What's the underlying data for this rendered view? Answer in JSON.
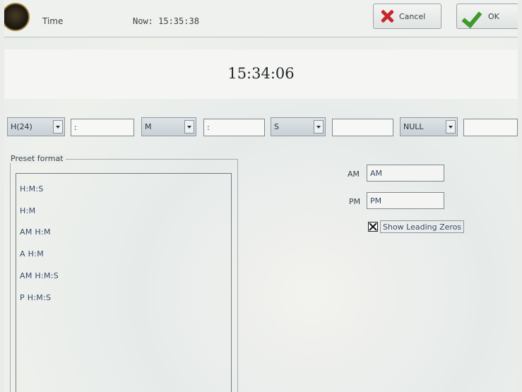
{
  "header": {
    "title": "Time",
    "now_label": "Now: 15:35:38",
    "cancel_label": "Cancel",
    "ok_label": "OK"
  },
  "clock": {
    "display": "15:34:06"
  },
  "format_row": {
    "hour_select": "H(24)",
    "sep1": ":",
    "minute_select": "M",
    "sep2": ":",
    "second_select": "S",
    "sep3": "",
    "ampm_select": "NULL",
    "sep4": ""
  },
  "preset": {
    "label": "Preset format",
    "items": [
      "H:M:S",
      "H:M",
      "AM H:M",
      "A H:M",
      "AM H:M:S",
      "P H:M:S"
    ]
  },
  "ampm": {
    "am_label": "AM",
    "am_value": "AM",
    "pm_label": "PM",
    "pm_value": "PM"
  },
  "options": {
    "show_leading_zeros_label": "Show Leading Zeros",
    "show_leading_zeros_checked": true
  }
}
